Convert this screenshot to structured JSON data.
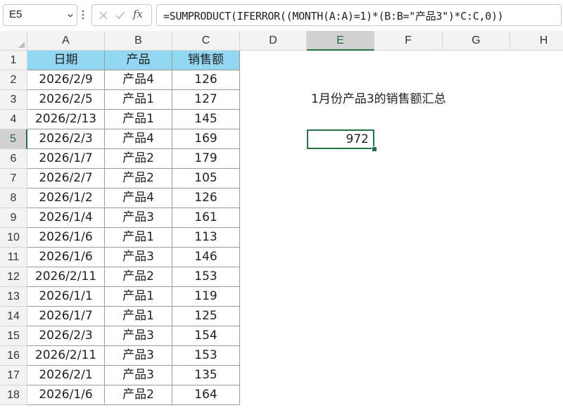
{
  "formula_bar": {
    "cell_ref": "E5",
    "formula": "=SUMPRODUCT(IFERROR((MONTH(A:A)=1)*(B:B=\"产品3\")*C:C,0))",
    "fx_label": "fx",
    "icons": [
      "chevron-down-icon",
      "more-vertical-icon",
      "cancel-x-icon",
      "confirm-check-icon",
      "fx-icon"
    ]
  },
  "columns": [
    "A",
    "B",
    "C",
    "D",
    "E",
    "F",
    "G",
    "H"
  ],
  "active_column": "E",
  "active_row": "5",
  "rows": [
    "1",
    "2",
    "3",
    "4",
    "5",
    "6",
    "7",
    "8",
    "9",
    "10",
    "11",
    "12",
    "13",
    "14",
    "15",
    "16",
    "17",
    "18"
  ],
  "table": {
    "headers": [
      "日期",
      "产品",
      "销售额"
    ],
    "data": [
      [
        "2026/2/9",
        "产品4",
        "126"
      ],
      [
        "2026/2/5",
        "产品1",
        "127"
      ],
      [
        "2026/2/13",
        "产品1",
        "145"
      ],
      [
        "2026/2/3",
        "产品4",
        "169"
      ],
      [
        "2026/1/7",
        "产品2",
        "179"
      ],
      [
        "2026/2/7",
        "产品2",
        "105"
      ],
      [
        "2026/1/2",
        "产品4",
        "126"
      ],
      [
        "2026/1/4",
        "产品3",
        "161"
      ],
      [
        "2026/1/6",
        "产品1",
        "113"
      ],
      [
        "2026/1/6",
        "产品3",
        "146"
      ],
      [
        "2026/2/11",
        "产品2",
        "153"
      ],
      [
        "2026/1/1",
        "产品1",
        "119"
      ],
      [
        "2026/1/7",
        "产品1",
        "125"
      ],
      [
        "2026/2/3",
        "产品3",
        "154"
      ],
      [
        "2026/2/11",
        "产品3",
        "153"
      ],
      [
        "2026/2/1",
        "产品3",
        "135"
      ],
      [
        "2026/1/6",
        "产品2",
        "164"
      ]
    ]
  },
  "summary": {
    "label": "1月份产品3的销售额汇总",
    "value": "972"
  },
  "colors": {
    "header_fill": "#92d8f2",
    "selection_green": "#217346",
    "header_bg": "#f3f3f3"
  }
}
